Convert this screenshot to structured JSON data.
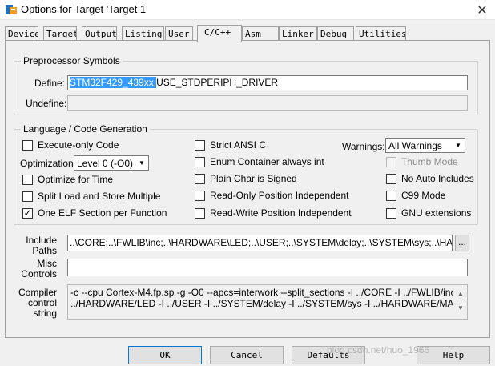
{
  "window": {
    "title": "Options for Target 'Target 1'",
    "close_glyph": "✕"
  },
  "tabs": [
    {
      "label": "Device"
    },
    {
      "label": "Target"
    },
    {
      "label": "Output"
    },
    {
      "label": "Listing"
    },
    {
      "label": "User"
    },
    {
      "label": "C/C++"
    },
    {
      "label": "Asm"
    },
    {
      "label": "Linker"
    },
    {
      "label": "Debug"
    },
    {
      "label": "Utilities"
    }
  ],
  "active_tab": "C/C++",
  "preprocessor": {
    "group_label": "Preprocessor Symbols",
    "define_label": "Define:",
    "define_selected": "STM32F429_439xx,",
    "define_rest": "USE_STDPERIPH_DRIVER",
    "undefine_label": "Undefine:",
    "undefine_value": ""
  },
  "language": {
    "group_label": "Language / Code Generation",
    "execute_only": {
      "label": "Execute-only Code",
      "checked": false
    },
    "optimization_label": "Optimization:",
    "optimization_value": "Level 0 (-O0)",
    "optimize_time": {
      "label": "Optimize for Time",
      "checked": false
    },
    "split_load": {
      "label": "Split Load and Store Multiple",
      "checked": false
    },
    "one_elf": {
      "label": "One ELF Section per Function",
      "checked": true
    },
    "strict_ansi": {
      "label": "Strict ANSI C",
      "checked": false
    },
    "enum_container": {
      "label": "Enum Container always int",
      "checked": false
    },
    "plain_char": {
      "label": "Plain Char is Signed",
      "checked": false
    },
    "ro_pos": {
      "label": "Read-Only Position Independent",
      "checked": false
    },
    "rw_pos": {
      "label": "Read-Write Position Independent",
      "checked": false
    },
    "warnings_label": "Warnings:",
    "warnings_value": "All Warnings",
    "thumb_mode": {
      "label": "Thumb Mode",
      "checked": false,
      "enabled": false
    },
    "no_auto_includes": {
      "label": "No Auto Includes",
      "checked": false
    },
    "c99_mode": {
      "label": "C99 Mode",
      "checked": false
    },
    "gnu_extensions": {
      "label": "GNU extensions",
      "checked": false
    }
  },
  "paths": {
    "include_label_1": "Include",
    "include_label_2": "Paths",
    "include_value": "..\\CORE;..\\FWLIB\\inc;..\\HARDWARE\\LED;..\\USER;..\\SYSTEM\\delay;..\\SYSTEM\\sys;..\\HARDW",
    "include_browse": "...",
    "misc_label_1": "Misc",
    "misc_label_2": "Controls",
    "misc_value": "",
    "compiler_label_1": "Compiler",
    "compiler_label_2": "control",
    "compiler_label_3": "string",
    "compiler_line_1": "-c --cpu Cortex-M4.fp.sp -g -O0 --apcs=interwork --split_sections -I ../CORE -I ../FWLIB/inc -I",
    "compiler_line_2": "../HARDWARE/LED -I ../USER -I ../SYSTEM/delay -I ../SYSTEM/sys -I ../HARDWARE/MALLOC"
  },
  "buttons": {
    "ok": "OK",
    "cancel": "Cancel",
    "defaults": "Defaults",
    "help": "Help"
  },
  "watermark": "blog.csdn.net/huo_1966"
}
